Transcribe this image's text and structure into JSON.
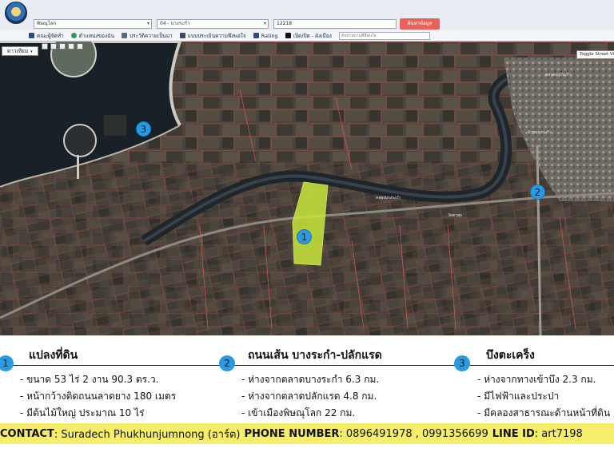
{
  "header": {
    "province_select": "พิษณุโลก",
    "district_select": "04 - บางระกำ",
    "parcel_input": "12218",
    "search_button": "ค้นหาข้อมูล"
  },
  "toolbar": {
    "items": [
      {
        "label": "คณะผู้จัดทำ",
        "icon": "team-icon"
      },
      {
        "label": "ตำแหน่งของฉัน",
        "icon": "location-icon"
      },
      {
        "label": "ประวัติความเป็นมา",
        "icon": "history-icon"
      },
      {
        "label": "แบบประเมินความพึงพอใจ",
        "icon": "survey-icon"
      },
      {
        "label": "Rating",
        "icon": "rating-icon"
      },
      {
        "label": "เปิด/ปิด - ผังเมือง",
        "icon": "layers-icon"
      }
    ],
    "search_placeholder": "ค้นหาสถานที่ที่สนใจ"
  },
  "map": {
    "map_type": "ดาวเทียม",
    "street_view_button": "Toggle Street View",
    "markers": [
      "3",
      "1",
      "2"
    ],
    "place_labels": [
      "ตลาดบางระกำ",
      "คลองบางระกำ",
      "วัดตาลบ",
      "บ้านบางระกำ"
    ]
  },
  "sections": [
    {
      "marker": "1",
      "title": "แปลงที่ดิน",
      "items": [
        "- ขนาด 53 ไร่ 2 งาน 90.3 ตร.ว.",
        "- หน้ากว้างติดถนนลาดยาง 180 เมตร",
        "- มีต้นไม้ใหญ่ ประมาณ 10 ไร่"
      ]
    },
    {
      "marker": "2",
      "title": "ถนนเส้น บางระกำ-ปลักแรด",
      "items": [
        "- ห่างจากตลาดบางระกำ 6.3 กม.",
        "- ห่างจากตลาดปลักแรด 4.8 กม.",
        "- เข้าเมืองพิษณุโลก 22 กม."
      ]
    },
    {
      "marker": "3",
      "title": "บึงตะเคร็ง",
      "items": [
        "- ห่างจากทางเข้าบึง 2.3 กม.",
        "- มีไฟฟ้าและประปา",
        "- มีคลองสาธารณะด้านหน้าที่ดิน"
      ]
    }
  ],
  "contact": {
    "contact_label": "CONTACT",
    "contact_name": ": Suradech Phukhunjumnong (อาร์ต)",
    "phone_label": "PHONE NUMBER",
    "phone_value": ": 0896491978 , 0991356699",
    "line_label": "LINE ID",
    "line_value": ": art7198"
  },
  "colors": {
    "header_bg": "#e9ecf3",
    "search_button": "#e8615a",
    "marker": "#2a9be0",
    "highlight_parcel": "#c8e63c",
    "contact_bar": "#f6ee6a"
  }
}
